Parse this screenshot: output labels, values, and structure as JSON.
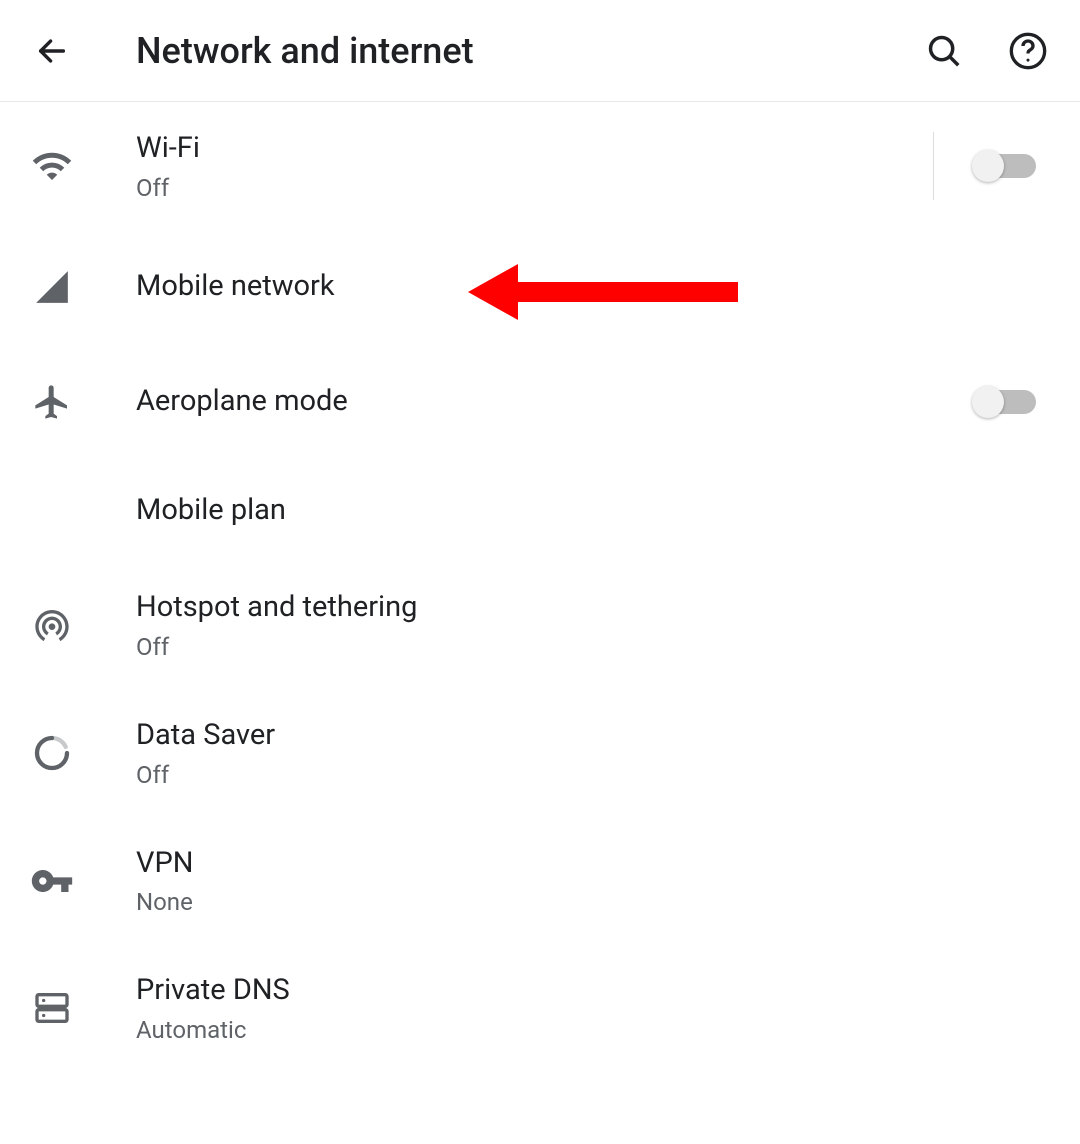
{
  "header": {
    "title": "Network and internet"
  },
  "items": [
    {
      "id": "wifi",
      "title": "Wi-Fi",
      "subtitle": "Off",
      "has_toggle": true,
      "toggle_on": false,
      "toggle_separator": true
    },
    {
      "id": "mobile-network",
      "title": "Mobile network",
      "subtitle": null,
      "has_toggle": false
    },
    {
      "id": "aeroplane-mode",
      "title": "Aeroplane mode",
      "subtitle": null,
      "has_toggle": true,
      "toggle_on": false,
      "toggle_separator": false
    },
    {
      "id": "mobile-plan",
      "title": "Mobile plan",
      "subtitle": null,
      "has_toggle": false,
      "no_icon": true
    },
    {
      "id": "hotspot",
      "title": "Hotspot and tethering",
      "subtitle": "Off",
      "has_toggle": false
    },
    {
      "id": "data-saver",
      "title": "Data Saver",
      "subtitle": "Off",
      "has_toggle": false
    },
    {
      "id": "vpn",
      "title": "VPN",
      "subtitle": "None",
      "has_toggle": false
    },
    {
      "id": "private-dns",
      "title": "Private DNS",
      "subtitle": "Automatic",
      "has_toggle": false
    }
  ],
  "annotation": {
    "type": "arrow-left",
    "color": "#ff0000"
  }
}
